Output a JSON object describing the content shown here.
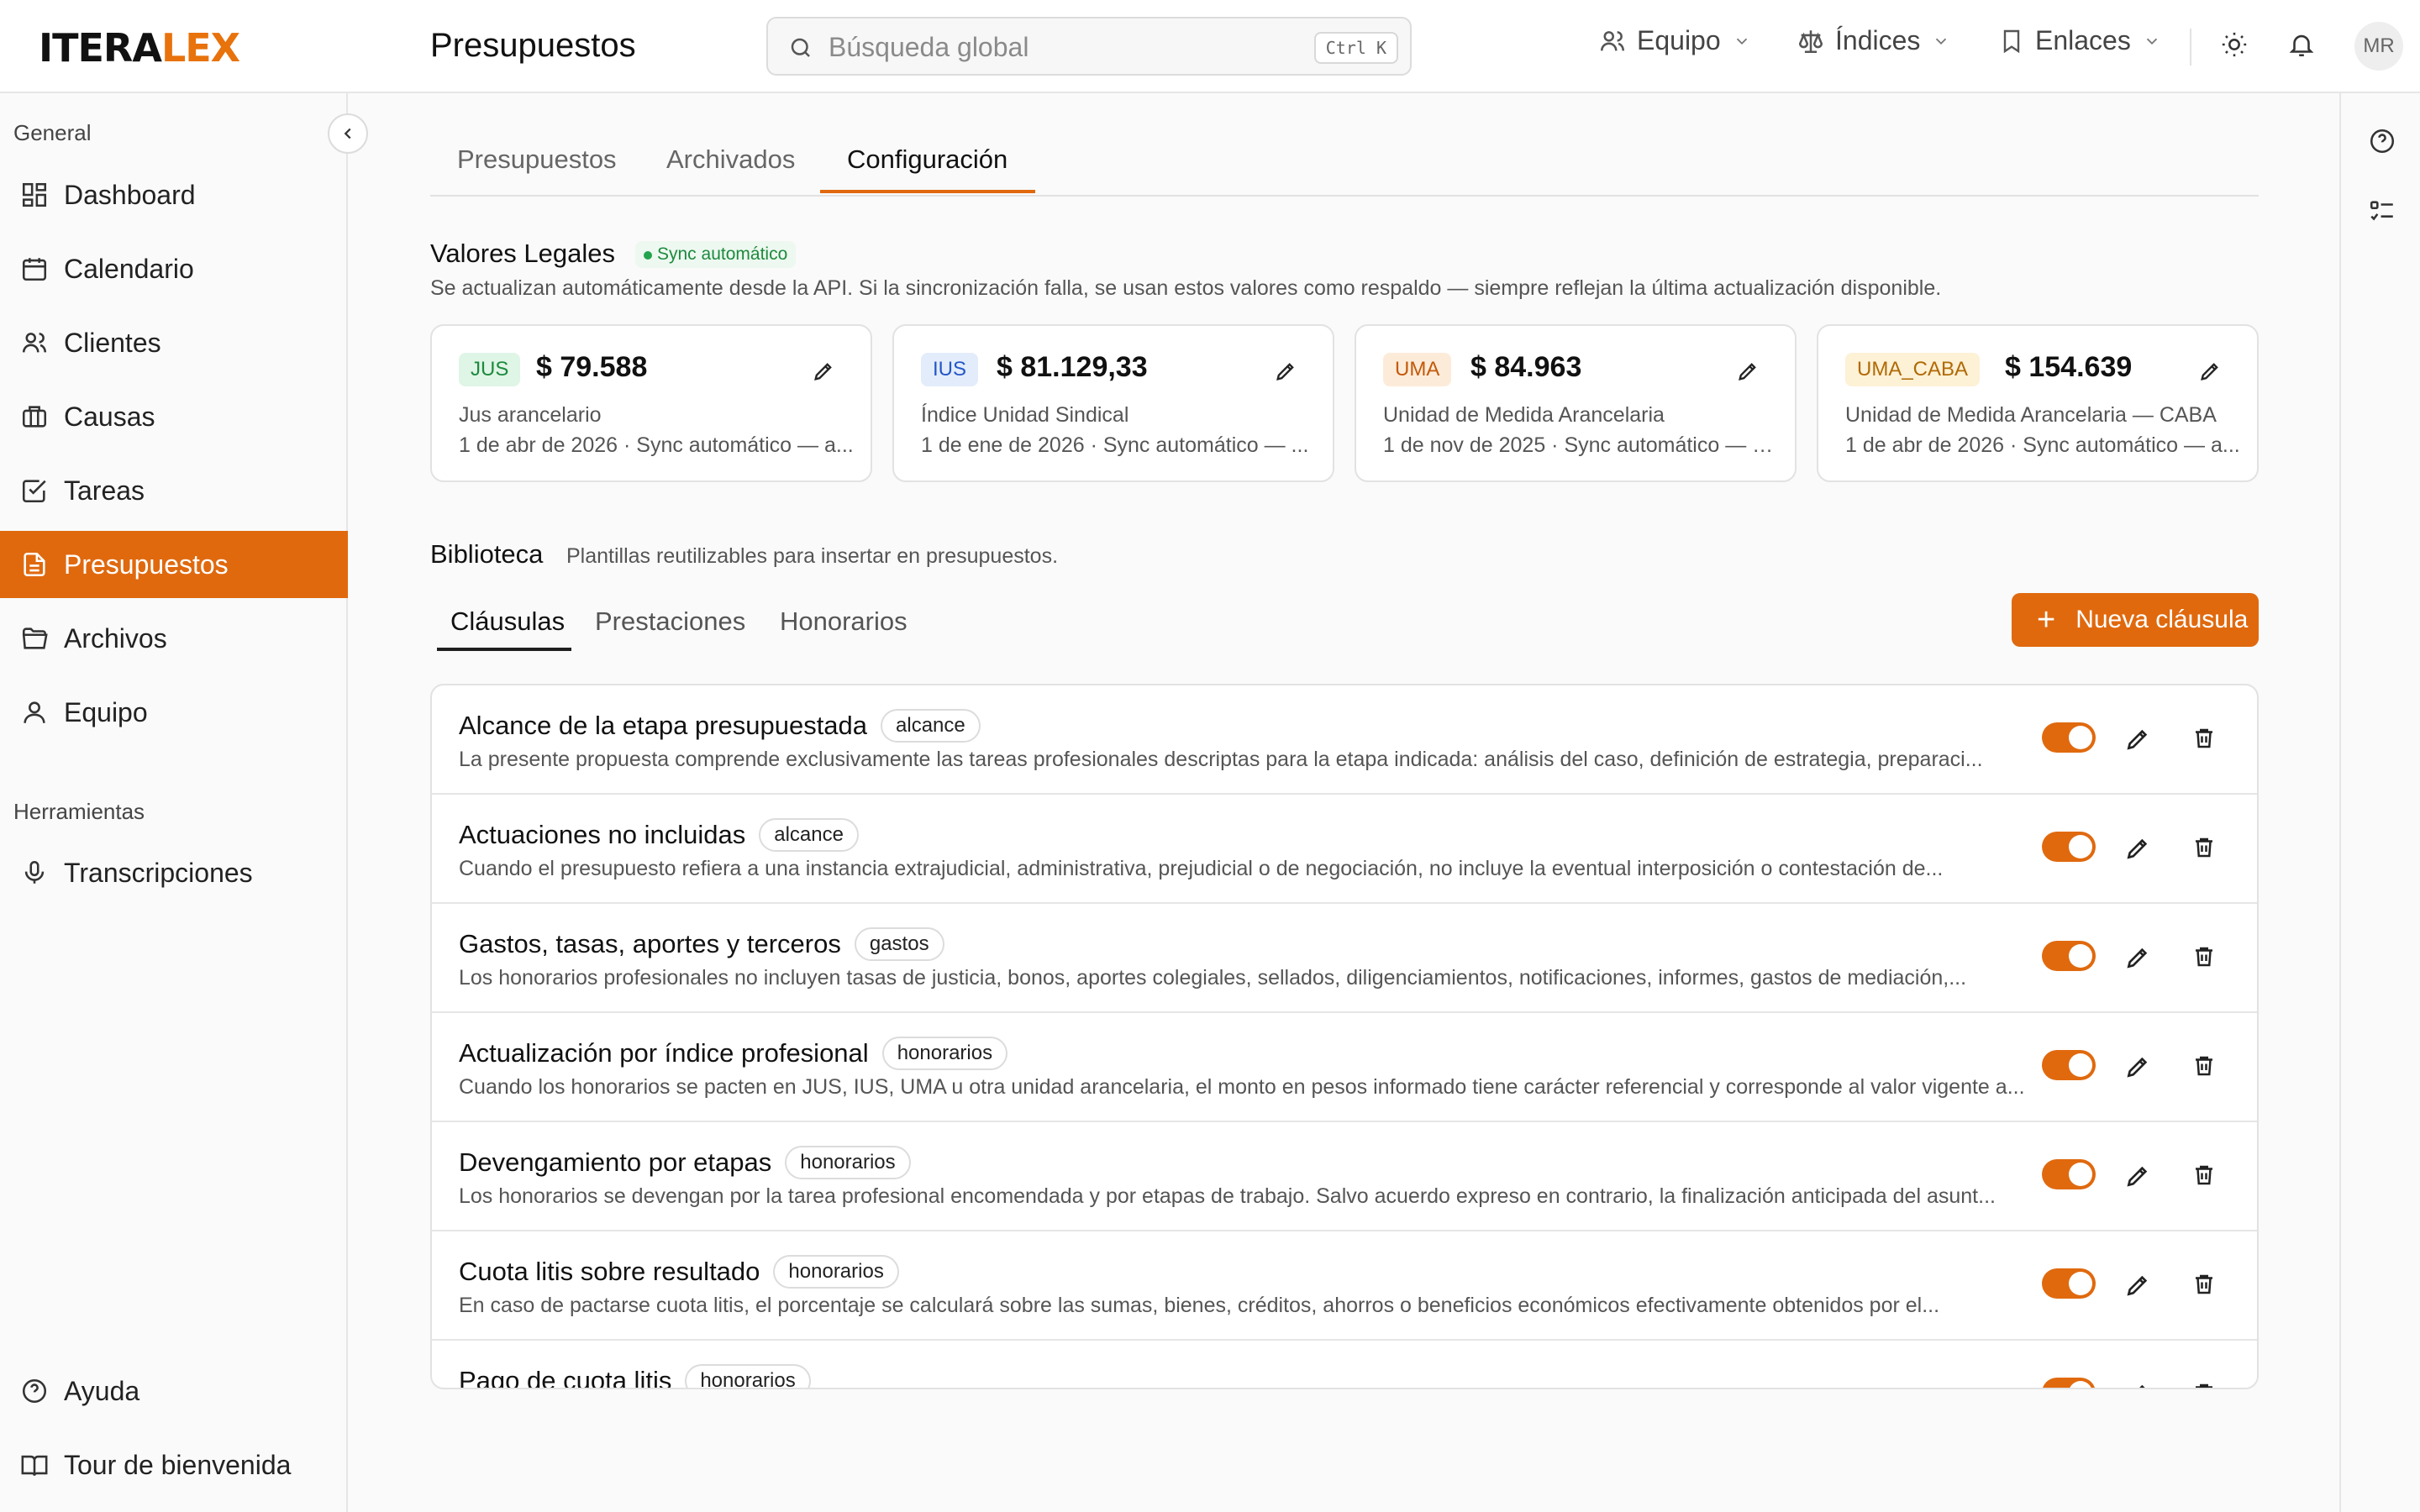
{
  "app": {
    "logo_main": "ITERA",
    "logo_accent": "LEX",
    "page_title": "Presupuestos"
  },
  "search": {
    "placeholder": "Búsqueda global",
    "shortcut": "Ctrl K"
  },
  "topnav": {
    "team": "Equipo",
    "indices": "Índices",
    "links": "Enlaces",
    "avatar": "MR"
  },
  "sidebar": {
    "general_header": "General",
    "items": [
      {
        "label": "Dashboard",
        "icon": "dashboard-icon"
      },
      {
        "label": "Calendario",
        "icon": "calendar-icon"
      },
      {
        "label": "Clientes",
        "icon": "users-icon"
      },
      {
        "label": "Causas",
        "icon": "briefcase-icon"
      },
      {
        "label": "Tareas",
        "icon": "checkbox-icon"
      },
      {
        "label": "Presupuestos",
        "icon": "document-icon",
        "active": true
      },
      {
        "label": "Archivos",
        "icon": "folder-icon"
      },
      {
        "label": "Equipo",
        "icon": "user-icon"
      }
    ],
    "tools_header": "Herramientas",
    "tools": [
      {
        "label": "Transcripciones",
        "icon": "microphone-icon"
      }
    ],
    "footer": [
      {
        "label": "Ayuda",
        "icon": "help-icon"
      },
      {
        "label": "Tour de bienvenida",
        "icon": "book-icon"
      }
    ]
  },
  "tabs": [
    "Presupuestos",
    "Archivados",
    "Configuración"
  ],
  "active_tab": "Configuración",
  "legal": {
    "title": "Valores Legales",
    "sync_badge": "Sync automático",
    "description": "Se actualizan automáticamente desde la API. Si la sincronización falla, se usan estos valores como respaldo — siempre reflejan la última actualización disponible.",
    "cards": [
      {
        "code": "JUS",
        "value": "$ 79.588",
        "name": "Jus arancelario",
        "meta": "1 de abr de 2026 · Sync automático — a...",
        "badge_bg": "#dff5e6",
        "badge_fg": "#1d8a3d"
      },
      {
        "code": "IUS",
        "value": "$ 81.129,33",
        "name": "Índice Unidad Sindical",
        "meta": "1 de ene de 2026 · Sync automático — ...",
        "badge_bg": "#e3ecfb",
        "badge_fg": "#2457c5"
      },
      {
        "code": "UMA",
        "value": "$ 84.963",
        "name": "Unidad de Medida Arancelaria",
        "meta": "1 de nov de 2025 · Sync automático — a...",
        "badge_bg": "#fdebd9",
        "badge_fg": "#c25a0a"
      },
      {
        "code": "UMA_CABA",
        "value": "$ 154.639",
        "name": "Unidad de Medida Arancelaria — CABA",
        "meta": "1 de abr de 2026 · Sync automático — a...",
        "badge_bg": "#fdf1d6",
        "badge_fg": "#b06a05"
      }
    ]
  },
  "library": {
    "title": "Biblioteca",
    "description": "Plantillas reutilizables para insertar en presupuestos.",
    "subtabs": [
      "Cláusulas",
      "Prestaciones",
      "Honorarios"
    ],
    "active_subtab": "Cláusulas",
    "new_button": "Nueva cláusula",
    "clauses": [
      {
        "title": "Alcance de la etapa presupuestada",
        "tag": "alcance",
        "description": "La presente propuesta comprende exclusivamente las tareas profesionales descriptas para la etapa indicada: análisis del caso, definición de estrategia, preparaci...",
        "enabled": true
      },
      {
        "title": "Actuaciones no incluidas",
        "tag": "alcance",
        "description": "Cuando el presupuesto refiera a una instancia extrajudicial, administrativa, prejudicial o de negociación, no incluye la eventual interposición o contestación de...",
        "enabled": true
      },
      {
        "title": "Gastos, tasas, aportes y terceros",
        "tag": "gastos",
        "description": "Los honorarios profesionales no incluyen tasas de justicia, bonos, aportes colegiales, sellados, diligenciamientos, notificaciones, informes, gastos de mediación,...",
        "enabled": true
      },
      {
        "title": "Actualización por índice profesional",
        "tag": "honorarios",
        "description": "Cuando los honorarios se pacten en JUS, IUS, UMA u otra unidad arancelaria, el monto en pesos informado tiene carácter referencial y corresponde al valor vigente a...",
        "enabled": true
      },
      {
        "title": "Devengamiento por etapas",
        "tag": "honorarios",
        "description": "Los honorarios se devengan por la tarea profesional encomendada y por etapas de trabajo. Salvo acuerdo expreso en contrario, la finalización anticipada del asunt...",
        "enabled": true
      },
      {
        "title": "Cuota litis sobre resultado",
        "tag": "honorarios",
        "description": "En caso de pactarse cuota litis, el porcentaje se calculará sobre las sumas, bienes, créditos, ahorros o beneficios económicos efectivamente obtenidos por el...",
        "enabled": true
      },
      {
        "title": "Pago de cuota litis",
        "tag": "honorarios",
        "description": "",
        "enabled": true
      }
    ]
  },
  "colors": {
    "accent": "#e0690e",
    "sync_green": "#1d8a3d"
  }
}
